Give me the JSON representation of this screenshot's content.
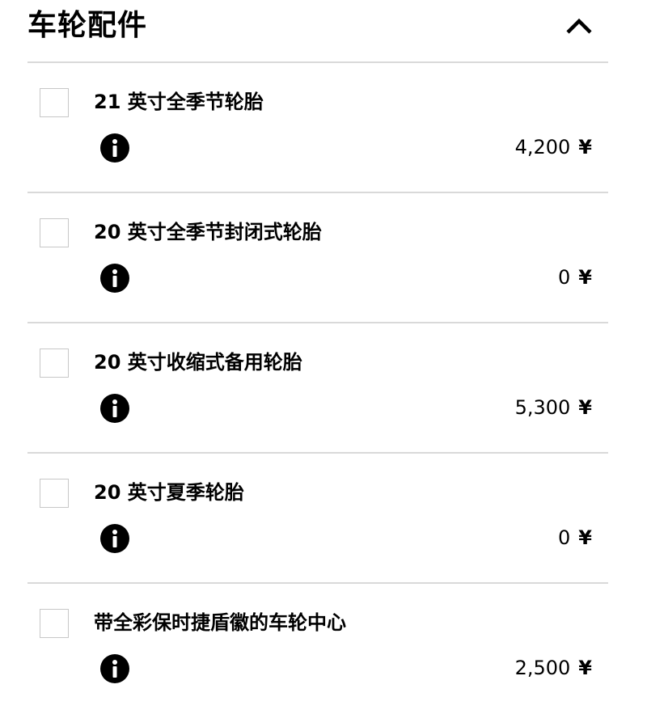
{
  "section": {
    "title": "车轮配件",
    "toggle_icon": "chevron-up-icon",
    "expanded": true
  },
  "options": [
    {
      "name": "21 英寸全季节轮胎",
      "price": "4,200",
      "currency": "¥",
      "checked": false,
      "info_icon": "info-icon"
    },
    {
      "name": "20 英寸全季节封闭式轮胎",
      "price": "0",
      "currency": "¥",
      "checked": false,
      "info_icon": "info-icon"
    },
    {
      "name": "20 英寸收缩式备用轮胎",
      "price": "5,300",
      "currency": "¥",
      "checked": false,
      "info_icon": "info-icon"
    },
    {
      "name": "20 英寸夏季轮胎",
      "price": "0",
      "currency": "¥",
      "checked": false,
      "info_icon": "info-icon"
    },
    {
      "name": "带全彩保时捷盾徽的车轮中心",
      "price": "2,500",
      "currency": "¥",
      "checked": false,
      "info_icon": "info-icon"
    }
  ]
}
